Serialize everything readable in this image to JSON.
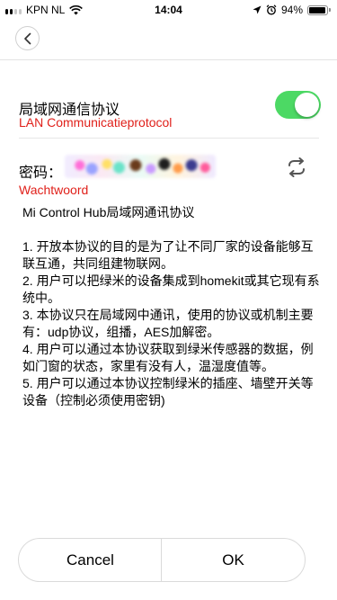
{
  "status_bar": {
    "carrier": "KPN NL",
    "time": "14:04",
    "battery_percent": "94%",
    "battery_level": 0.94,
    "icons": [
      "signal-icon",
      "wifi-icon",
      "location-arrow-icon",
      "alarm-icon"
    ]
  },
  "nav": {
    "back_icon": "chevron-left-icon"
  },
  "lan": {
    "title": "局域网通信协议",
    "subtitle": "LAN Communicatieprotocol",
    "toggle_on": true,
    "toggle_color": "#4cd964"
  },
  "password": {
    "label": "密码：",
    "subtitle": "Wachtwoord",
    "refresh_icon": "refresh-icon"
  },
  "protocol": {
    "heading": "Mi Control Hub局域网通讯协议",
    "items": [
      "1. 开放本协议的目的是为了让不同厂家的设备能够互联互通，共同组建物联网。",
      "2. 用户可以把绿米的设备集成到homekit或其它现有系统中。",
      "3. 本协议只在局域网中通讯，使用的协议或机制主要有：udp协议，组播，AES加解密。",
      "4. 用户可以通过本协议获取到绿米传感器的数据，例如门窗的状态，家里有没有人，温湿度值等。",
      "5. 用户可以通过本协议控制绿米的插座、墙壁开关等设备（控制必须使用密钥)"
    ]
  },
  "buttons": {
    "cancel": "Cancel",
    "ok": "OK"
  },
  "colors": {
    "accent_red": "#e0201a",
    "toggle_green": "#4cd964"
  }
}
